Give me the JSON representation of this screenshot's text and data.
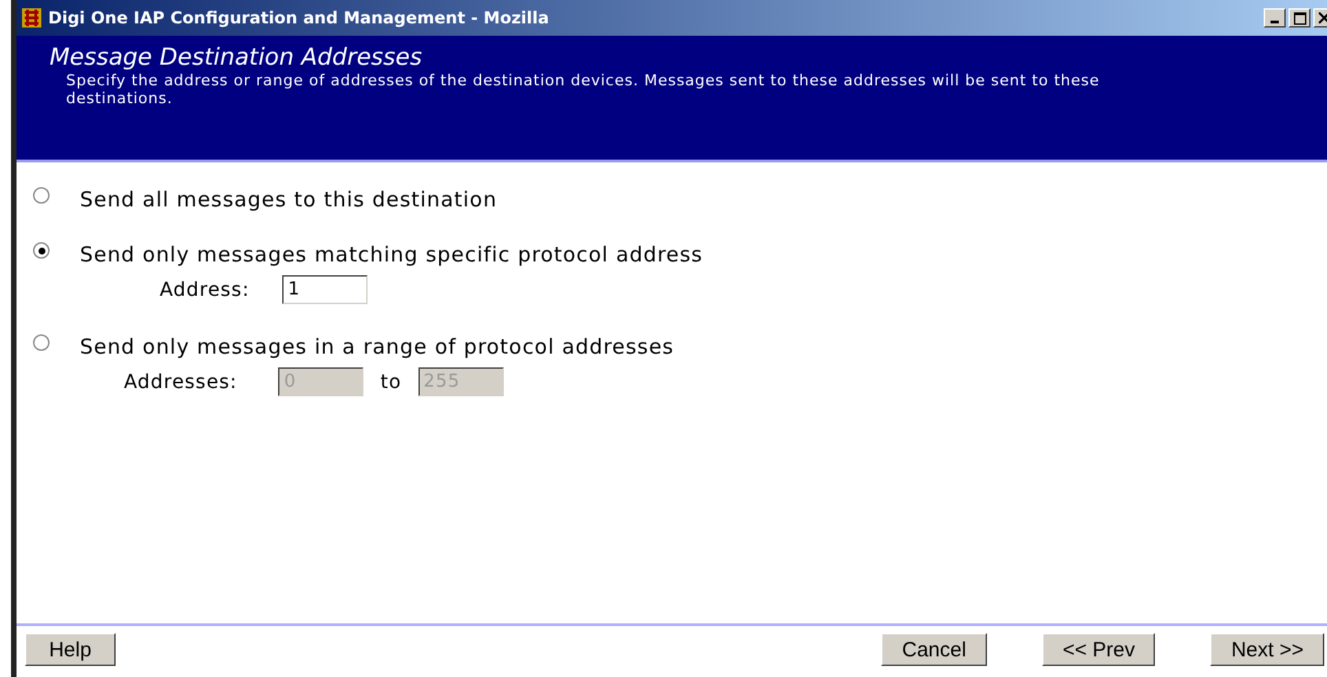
{
  "window": {
    "title": "Digi One IAP Configuration and Management - Mozilla"
  },
  "header": {
    "title": "Message Destination Addresses",
    "description": "Specify the address or range of addresses of the destination devices. Messages sent to these addresses will be sent to these destinations."
  },
  "options": [
    {
      "kind": "plain",
      "label": "Send all messages to this destination",
      "selected": false
    },
    {
      "kind": "address",
      "label": "Send only messages matching specific protocol address",
      "selected": true,
      "field_label": "Address:",
      "value": "1",
      "disabled": false
    },
    {
      "kind": "range",
      "label": "Send only messages in a range of protocol addresses",
      "selected": false,
      "field_label": "Addresses:",
      "from": "0",
      "separator": "to",
      "to": "255",
      "disabled": true
    }
  ],
  "buttons": {
    "help": "Help",
    "actions": [
      "Cancel",
      "<< Prev",
      "Next >>"
    ]
  }
}
